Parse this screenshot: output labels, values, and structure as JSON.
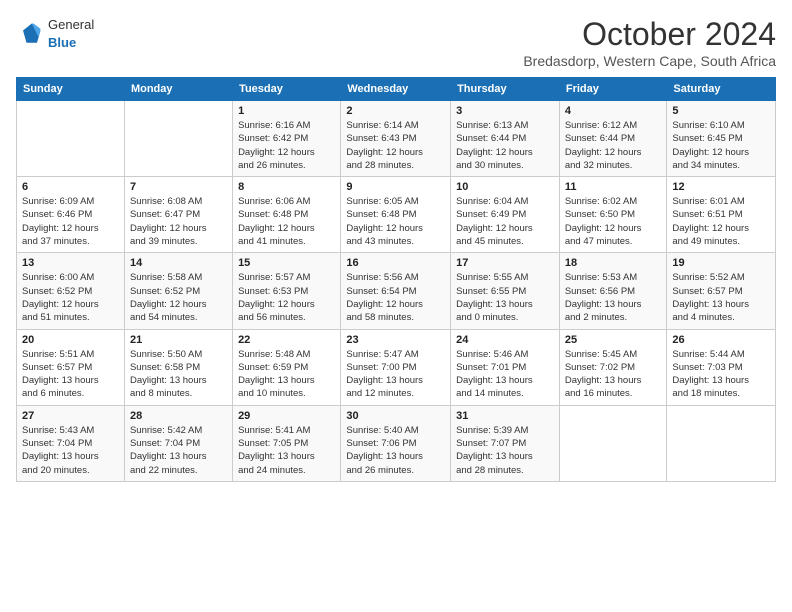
{
  "logo": {
    "general": "General",
    "blue": "Blue"
  },
  "title": "October 2024",
  "location": "Bredasdorp, Western Cape, South Africa",
  "weekdays": [
    "Sunday",
    "Monday",
    "Tuesday",
    "Wednesday",
    "Thursday",
    "Friday",
    "Saturday"
  ],
  "weeks": [
    [
      {
        "day": "",
        "info": ""
      },
      {
        "day": "",
        "info": ""
      },
      {
        "day": "1",
        "info": "Sunrise: 6:16 AM\nSunset: 6:42 PM\nDaylight: 12 hours\nand 26 minutes."
      },
      {
        "day": "2",
        "info": "Sunrise: 6:14 AM\nSunset: 6:43 PM\nDaylight: 12 hours\nand 28 minutes."
      },
      {
        "day": "3",
        "info": "Sunrise: 6:13 AM\nSunset: 6:44 PM\nDaylight: 12 hours\nand 30 minutes."
      },
      {
        "day": "4",
        "info": "Sunrise: 6:12 AM\nSunset: 6:44 PM\nDaylight: 12 hours\nand 32 minutes."
      },
      {
        "day": "5",
        "info": "Sunrise: 6:10 AM\nSunset: 6:45 PM\nDaylight: 12 hours\nand 34 minutes."
      }
    ],
    [
      {
        "day": "6",
        "info": "Sunrise: 6:09 AM\nSunset: 6:46 PM\nDaylight: 12 hours\nand 37 minutes."
      },
      {
        "day": "7",
        "info": "Sunrise: 6:08 AM\nSunset: 6:47 PM\nDaylight: 12 hours\nand 39 minutes."
      },
      {
        "day": "8",
        "info": "Sunrise: 6:06 AM\nSunset: 6:48 PM\nDaylight: 12 hours\nand 41 minutes."
      },
      {
        "day": "9",
        "info": "Sunrise: 6:05 AM\nSunset: 6:48 PM\nDaylight: 12 hours\nand 43 minutes."
      },
      {
        "day": "10",
        "info": "Sunrise: 6:04 AM\nSunset: 6:49 PM\nDaylight: 12 hours\nand 45 minutes."
      },
      {
        "day": "11",
        "info": "Sunrise: 6:02 AM\nSunset: 6:50 PM\nDaylight: 12 hours\nand 47 minutes."
      },
      {
        "day": "12",
        "info": "Sunrise: 6:01 AM\nSunset: 6:51 PM\nDaylight: 12 hours\nand 49 minutes."
      }
    ],
    [
      {
        "day": "13",
        "info": "Sunrise: 6:00 AM\nSunset: 6:52 PM\nDaylight: 12 hours\nand 51 minutes."
      },
      {
        "day": "14",
        "info": "Sunrise: 5:58 AM\nSunset: 6:52 PM\nDaylight: 12 hours\nand 54 minutes."
      },
      {
        "day": "15",
        "info": "Sunrise: 5:57 AM\nSunset: 6:53 PM\nDaylight: 12 hours\nand 56 minutes."
      },
      {
        "day": "16",
        "info": "Sunrise: 5:56 AM\nSunset: 6:54 PM\nDaylight: 12 hours\nand 58 minutes."
      },
      {
        "day": "17",
        "info": "Sunrise: 5:55 AM\nSunset: 6:55 PM\nDaylight: 13 hours\nand 0 minutes."
      },
      {
        "day": "18",
        "info": "Sunrise: 5:53 AM\nSunset: 6:56 PM\nDaylight: 13 hours\nand 2 minutes."
      },
      {
        "day": "19",
        "info": "Sunrise: 5:52 AM\nSunset: 6:57 PM\nDaylight: 13 hours\nand 4 minutes."
      }
    ],
    [
      {
        "day": "20",
        "info": "Sunrise: 5:51 AM\nSunset: 6:57 PM\nDaylight: 13 hours\nand 6 minutes."
      },
      {
        "day": "21",
        "info": "Sunrise: 5:50 AM\nSunset: 6:58 PM\nDaylight: 13 hours\nand 8 minutes."
      },
      {
        "day": "22",
        "info": "Sunrise: 5:48 AM\nSunset: 6:59 PM\nDaylight: 13 hours\nand 10 minutes."
      },
      {
        "day": "23",
        "info": "Sunrise: 5:47 AM\nSunset: 7:00 PM\nDaylight: 13 hours\nand 12 minutes."
      },
      {
        "day": "24",
        "info": "Sunrise: 5:46 AM\nSunset: 7:01 PM\nDaylight: 13 hours\nand 14 minutes."
      },
      {
        "day": "25",
        "info": "Sunrise: 5:45 AM\nSunset: 7:02 PM\nDaylight: 13 hours\nand 16 minutes."
      },
      {
        "day": "26",
        "info": "Sunrise: 5:44 AM\nSunset: 7:03 PM\nDaylight: 13 hours\nand 18 minutes."
      }
    ],
    [
      {
        "day": "27",
        "info": "Sunrise: 5:43 AM\nSunset: 7:04 PM\nDaylight: 13 hours\nand 20 minutes."
      },
      {
        "day": "28",
        "info": "Sunrise: 5:42 AM\nSunset: 7:04 PM\nDaylight: 13 hours\nand 22 minutes."
      },
      {
        "day": "29",
        "info": "Sunrise: 5:41 AM\nSunset: 7:05 PM\nDaylight: 13 hours\nand 24 minutes."
      },
      {
        "day": "30",
        "info": "Sunrise: 5:40 AM\nSunset: 7:06 PM\nDaylight: 13 hours\nand 26 minutes."
      },
      {
        "day": "31",
        "info": "Sunrise: 5:39 AM\nSunset: 7:07 PM\nDaylight: 13 hours\nand 28 minutes."
      },
      {
        "day": "",
        "info": ""
      },
      {
        "day": "",
        "info": ""
      }
    ]
  ]
}
